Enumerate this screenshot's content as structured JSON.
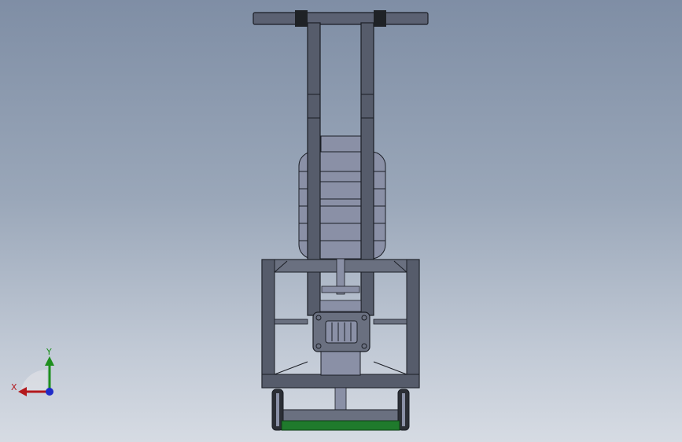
{
  "viewport": {
    "background_top": "#7f8ea5",
    "background_bottom": "#d6dbe3"
  },
  "model": {
    "frame_color": "#565c6b",
    "edge_color": "#1b1e25",
    "component_color": "#8a90a6",
    "grip_color": "#1f2226",
    "brush_color": "#1f7a2c"
  },
  "triad": {
    "x_label": "X",
    "y_label": "Y",
    "x_color": "#b3181c",
    "y_color": "#1e8f1e",
    "z_color": "#1f2bc8"
  }
}
